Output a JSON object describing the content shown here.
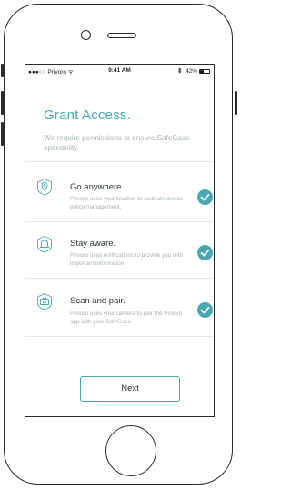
{
  "status_bar": {
    "carrier": "●●●○○ Privoro ᯤ",
    "time": "9:41 AM",
    "battery_percent": "42%",
    "battery_level": 0.42,
    "bluetooth_icon": "bluetooth-icon"
  },
  "header": {
    "title": "Grant Access.",
    "subtitle": "We require permissions to ensure SafeCase operability"
  },
  "permissions": [
    {
      "icon": "location-pin-icon",
      "title": "Go anywhere.",
      "description": "Privoro uses your location to facilitate device policy management.",
      "granted": true
    },
    {
      "icon": "bell-icon",
      "title": "Stay aware.",
      "description": "Privoro uses notifications to provide you with important information.",
      "granted": true
    },
    {
      "icon": "camera-icon",
      "title": "Scan and pair.",
      "description": "Privoro uses your camera to pair the Privoro app with your SafeCase.",
      "granted": true
    }
  ],
  "next_button": {
    "label": "Next"
  },
  "colors": {
    "accent": "#49a9b2",
    "text_primary": "#2c3a3d",
    "text_secondary": "#a6b3b6",
    "divider": "#e6e9ea"
  }
}
